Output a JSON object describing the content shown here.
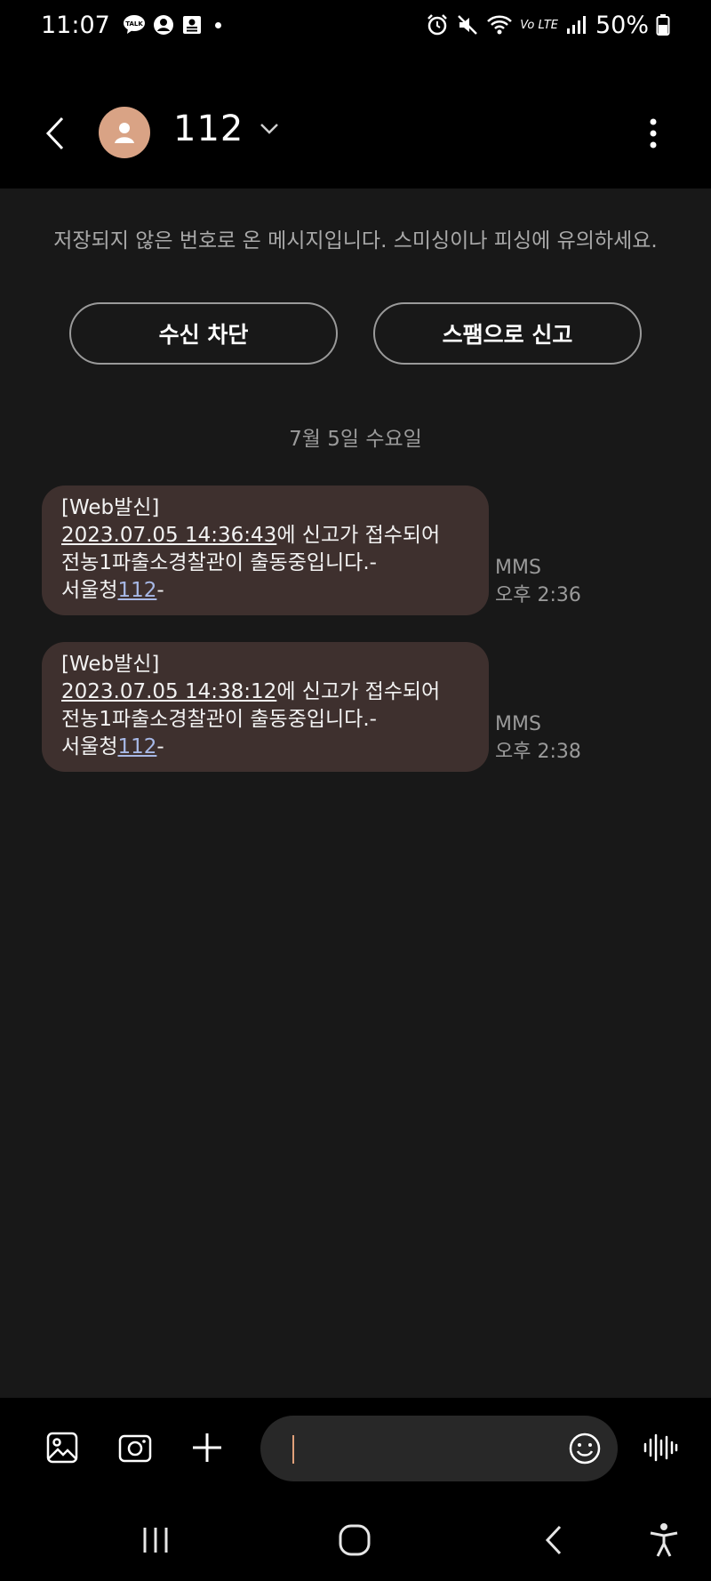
{
  "status_bar": {
    "time": "11:07",
    "battery": "50%",
    "network_label": "Vo LTE",
    "left_icons": [
      "kakaotalk-icon",
      "profile-icon",
      "contact-card-icon",
      "dot-icon"
    ],
    "right_icons": [
      "alarm-icon",
      "mute-icon",
      "wifi-icon",
      "signal-icon",
      "battery-icon"
    ]
  },
  "header": {
    "contact_name": "112",
    "icons": [
      "back-icon",
      "avatar-icon",
      "chevron-down-icon",
      "more-vert-icon"
    ]
  },
  "warning": {
    "text": "저장되지 않은 번호로 온 메시지입니다. 스미싱이나 피싱에 유의하세요.",
    "block_label": "수신 차단",
    "spam_label": "스팸으로 신고"
  },
  "date_divider": "7월 5일 수요일",
  "messages": [
    {
      "line1": "[Web발신]",
      "datetime": "2023.07.05 14:36:43",
      "line2_rest": "에 신고가 접수되어",
      "line3": "전농1파출소경찰관이 출동중입니다.-",
      "line4_pre": "서울청",
      "line4_link": "112",
      "line4_post": "-",
      "type": "MMS",
      "time": "오후 2:36"
    },
    {
      "line1": "[Web발신]",
      "datetime": "2023.07.05 14:38:12",
      "line2_rest": "에 신고가 접수되어",
      "line3": "전농1파출소경찰관이 출동중입니다.-",
      "line4_pre": "서울청",
      "line4_link": "112",
      "line4_post": "-",
      "type": "MMS",
      "time": "오후 2:38"
    }
  ],
  "composer": {
    "input_value": "",
    "icons": [
      "gallery-icon",
      "camera-icon",
      "plus-icon",
      "emoji-icon",
      "voice-icon"
    ]
  },
  "nav_bar": {
    "icons": [
      "recent-apps-icon",
      "home-icon",
      "back-nav-icon",
      "accessibility-icon"
    ]
  },
  "colors": {
    "background": "#000000",
    "conversation_bg": "#181818",
    "bubble": "#3e302e",
    "avatar": "#d9a385",
    "link": "#a7b8e6",
    "secondary_text": "#9a9a9a"
  }
}
